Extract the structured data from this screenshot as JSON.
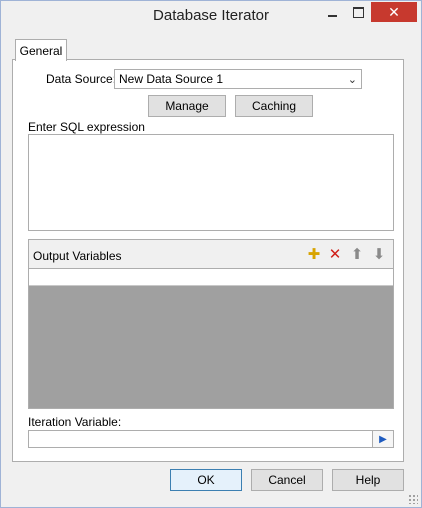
{
  "window": {
    "title": "Database Iterator",
    "minimize_icon": "minimize-icon",
    "maximize_icon": "maximize-icon",
    "close_icon": "close-icon",
    "close_glyph": "✕"
  },
  "tabs": [
    {
      "label": "General",
      "active": true
    }
  ],
  "data_source": {
    "label": "Data Source:",
    "selected": "New Data Source 1",
    "dropdown_icon": "chevron-down-icon",
    "dropdown_glyph": "⌄"
  },
  "buttons": {
    "manage": "Manage",
    "caching": "Caching",
    "ok": "OK",
    "cancel": "Cancel",
    "help": "Help"
  },
  "sql": {
    "label": "Enter SQL expression",
    "value": ""
  },
  "output_variables": {
    "title": "Output Variables",
    "toolbar": [
      {
        "icon": "new-item-icon",
        "glyph": "✚",
        "color": "#d8a400"
      },
      {
        "icon": "delete-icon",
        "glyph": "✕",
        "color": "#d0201a"
      },
      {
        "icon": "arrow-up-icon",
        "glyph": "⬆",
        "color": "#8a8a8a"
      },
      {
        "icon": "arrow-down-icon",
        "glyph": "⬇",
        "color": "#8a8a8a"
      }
    ],
    "rows": []
  },
  "iteration_variable": {
    "label": "Iteration Variable:",
    "value": "",
    "picker_icon": "play-icon",
    "picker_glyph": "▶"
  },
  "colors": {
    "close_button": "#c7392e",
    "grid_empty": "#a0a0a0",
    "default_button_border": "#3c7fb1"
  }
}
